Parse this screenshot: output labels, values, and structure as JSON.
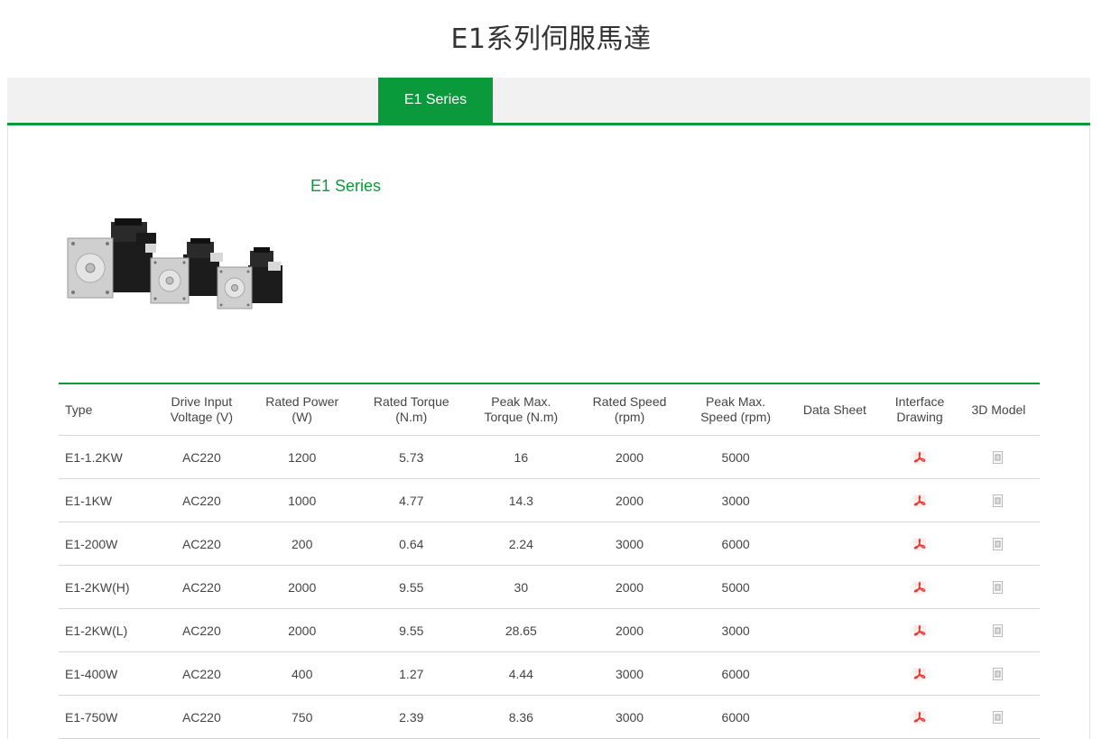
{
  "page": {
    "title": "E1系列伺服馬達"
  },
  "tabs": [
    {
      "label": "E1 Series",
      "active": true
    }
  ],
  "series": {
    "title": "E1 Series"
  },
  "colors": {
    "accent": "#0a9a3c",
    "pdf": "#e53935",
    "tab_bar": "#f1f1f1"
  },
  "table": {
    "headers": [
      "Type",
      "Drive Input Voltage (V)",
      "Rated Power (W)",
      "Rated Torque (N.m)",
      "Peak Max. Torque (N.m)",
      "Rated Speed (rpm)",
      "Peak Max. Speed (rpm)",
      "Data Sheet",
      "Interface Drawing",
      "3D Model"
    ],
    "header_lines": [
      [
        "Type"
      ],
      [
        "Drive Input",
        "Voltage (V)"
      ],
      [
        "Rated Power",
        "(W)"
      ],
      [
        "Rated Torque",
        "(N.m)"
      ],
      [
        "Peak Max.",
        "Torque (N.m)"
      ],
      [
        "Rated Speed",
        "(rpm)"
      ],
      [
        "Peak Max.",
        "Speed (rpm)"
      ],
      [
        "Data Sheet"
      ],
      [
        "Interface",
        "Drawing"
      ],
      [
        "3D Model"
      ]
    ],
    "rows": [
      {
        "type": "E1-1.2KW",
        "voltage": "AC220",
        "power": "1200",
        "torque": "5.73",
        "peak_torque": "16",
        "speed": "2000",
        "peak_speed": "5000",
        "interface_icon": "pdf-icon",
        "model_icon": "3d-model-icon"
      },
      {
        "type": "E1-1KW",
        "voltage": "AC220",
        "power": "1000",
        "torque": "4.77",
        "peak_torque": "14.3",
        "speed": "2000",
        "peak_speed": "3000",
        "interface_icon": "pdf-icon",
        "model_icon": "3d-model-icon"
      },
      {
        "type": "E1-200W",
        "voltage": "AC220",
        "power": "200",
        "torque": "0.64",
        "peak_torque": "2.24",
        "speed": "3000",
        "peak_speed": "6000",
        "interface_icon": "pdf-icon",
        "model_icon": "3d-model-icon"
      },
      {
        "type": "E1-2KW(H)",
        "voltage": "AC220",
        "power": "2000",
        "torque": "9.55",
        "peak_torque": "30",
        "speed": "2000",
        "peak_speed": "5000",
        "interface_icon": "pdf-icon",
        "model_icon": "3d-model-icon"
      },
      {
        "type": "E1-2KW(L)",
        "voltage": "AC220",
        "power": "2000",
        "torque": "9.55",
        "peak_torque": "28.65",
        "speed": "2000",
        "peak_speed": "3000",
        "interface_icon": "pdf-icon",
        "model_icon": "3d-model-icon"
      },
      {
        "type": "E1-400W",
        "voltage": "AC220",
        "power": "400",
        "torque": "1.27",
        "peak_torque": "4.44",
        "speed": "3000",
        "peak_speed": "6000",
        "interface_icon": "pdf-icon",
        "model_icon": "3d-model-icon"
      },
      {
        "type": "E1-750W",
        "voltage": "AC220",
        "power": "750",
        "torque": "2.39",
        "peak_torque": "8.36",
        "speed": "3000",
        "peak_speed": "6000",
        "interface_icon": "pdf-icon",
        "model_icon": "3d-model-icon"
      }
    ]
  }
}
